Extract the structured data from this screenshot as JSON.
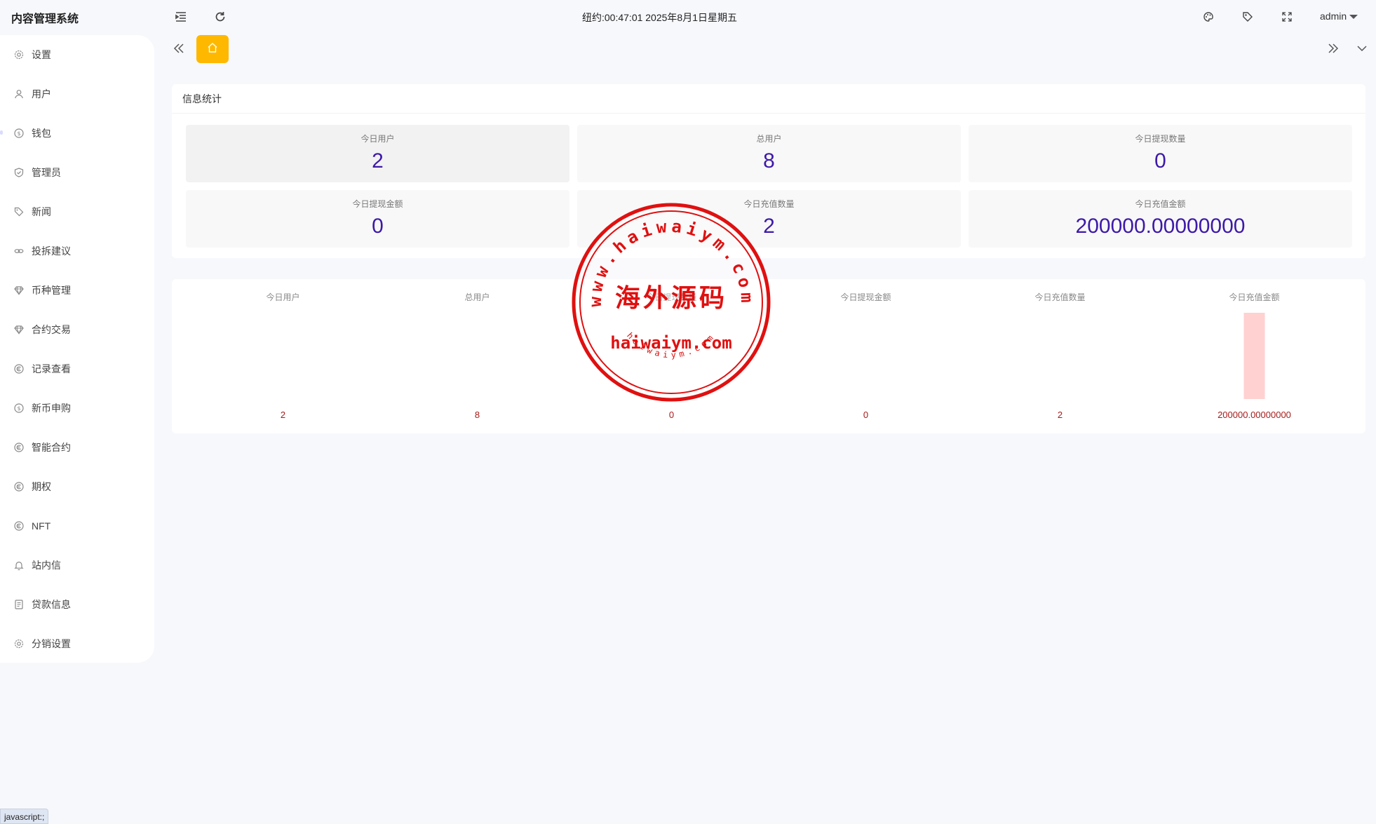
{
  "app": {
    "title": "内容管理系统"
  },
  "header": {
    "datetime": "纽约:00:47:01 2025年8月1日星期五",
    "user": "admin",
    "icons": [
      "menu-fold-icon",
      "refresh-icon",
      "theme-palette-icon",
      "tag-icon",
      "fullscreen-icon"
    ]
  },
  "sidebar": {
    "items": [
      {
        "label": "设置",
        "icon": "gear-icon"
      },
      {
        "label": "用户",
        "icon": "user-icon"
      },
      {
        "label": "钱包",
        "icon": "dollar-icon"
      },
      {
        "label": "管理员",
        "icon": "shield-icon"
      },
      {
        "label": "新闻",
        "icon": "tag-icon"
      },
      {
        "label": "投拆建议",
        "icon": "link-icon"
      },
      {
        "label": "币种管理",
        "icon": "diamond-icon"
      },
      {
        "label": "合约交易",
        "icon": "diamond-icon"
      },
      {
        "label": "记录查看",
        "icon": "currency-icon"
      },
      {
        "label": "新币申购",
        "icon": "dollar-icon"
      },
      {
        "label": "智能合约",
        "icon": "currency-icon"
      },
      {
        "label": "期权",
        "icon": "currency-icon"
      },
      {
        "label": "NFT",
        "icon": "currency-icon"
      },
      {
        "label": "站内信",
        "icon": "bell-icon"
      },
      {
        "label": "贷款信息",
        "icon": "file-icon"
      },
      {
        "label": "分销设置",
        "icon": "gear-icon"
      }
    ]
  },
  "tabs": {
    "home_icon": "home-icon",
    "prev_icon": "double-chevron-left-icon",
    "next_icon": "double-chevron-right-icon",
    "more_icon": "chevron-down-icon"
  },
  "stats": {
    "title": "信息统计",
    "cards": [
      {
        "label": "今日用户",
        "value": "2"
      },
      {
        "label": "总用户",
        "value": "8"
      },
      {
        "label": "今日提现数量",
        "value": "0"
      },
      {
        "label": "今日提现金额",
        "value": "0"
      },
      {
        "label": "今日充值数量",
        "value": "2"
      },
      {
        "label": "今日充值金额",
        "value": "200000.00000000"
      }
    ]
  },
  "chart_data": {
    "type": "bar",
    "categories": [
      "今日用户",
      "总用户",
      "今日提现数量",
      "今日提现金额",
      "今日充值数量",
      "今日充值金额"
    ],
    "values": [
      2,
      8,
      0,
      0,
      2,
      200000.0
    ],
    "value_labels": [
      "2",
      "8",
      "0",
      "0",
      "2",
      "200000.00000000"
    ],
    "bar_color": "#ffd1d1",
    "label_color": "#a61b1b",
    "category_color": "#888888"
  },
  "watermark": {
    "top_arc": "www.haiwaiym.com",
    "main": "海外源码",
    "domain": "haiwaiym.com",
    "bottom_arc": "haiwaiym.com",
    "color": "#e01010"
  },
  "statusbar": {
    "text": "javascript:;"
  }
}
